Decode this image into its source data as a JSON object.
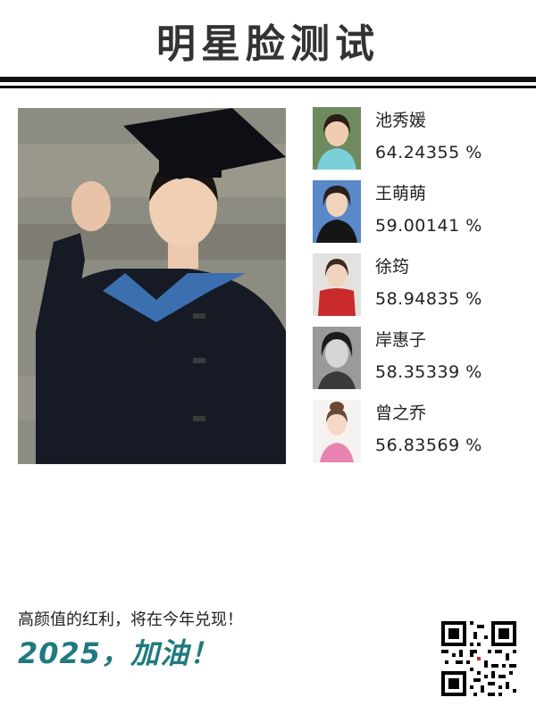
{
  "header": {
    "title": "明星脸测试"
  },
  "matches": [
    {
      "name": "池秀媛",
      "percent": "64.24355 %"
    },
    {
      "name": "王萌萌",
      "percent": "59.00141 %"
    },
    {
      "name": "徐筠",
      "percent": "58.94835 %"
    },
    {
      "name": "岸惠子",
      "percent": "58.35339 %"
    },
    {
      "name": "曾之乔",
      "percent": "56.83569 %"
    }
  ],
  "footer": {
    "slogan": "高颜值的红利，将在今年兑现！",
    "year_text": "2025，加油！"
  },
  "colors": {
    "accent": "#1f7a80",
    "rule": "#111111",
    "title": "#333333"
  }
}
